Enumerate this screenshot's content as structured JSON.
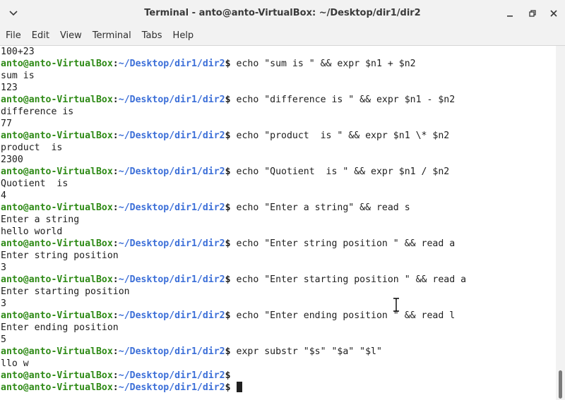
{
  "window": {
    "title": "Terminal - anto@anto-VirtualBox: ~/Desktop/dir1/dir2"
  },
  "menubar": {
    "items": [
      "File",
      "Edit",
      "View",
      "Terminal",
      "Tabs",
      "Help"
    ]
  },
  "prompt": {
    "user": "anto@anto-VirtualBox",
    "path": "~/Desktop/dir1/dir2",
    "colon": ":",
    "dollar": "$"
  },
  "terminal": {
    "output_0": "100+23",
    "cmd_1": " echo \"sum is \" && expr $n1 + $n2",
    "output_1a": "sum is",
    "output_1b": "123",
    "cmd_2": " echo \"difference is \" && expr $n1 - $n2",
    "output_2a": "difference is",
    "output_2b": "77",
    "cmd_3": " echo \"product  is \" && expr $n1 \\* $n2",
    "output_3a": "product  is",
    "output_3b": "2300",
    "cmd_4": " echo \"Quotient  is \" && expr $n1 / $n2",
    "output_4a": "Quotient  is",
    "output_4b": "4",
    "cmd_5": " echo \"Enter a string\" && read s",
    "output_5a": "Enter a string",
    "output_5b": "hello world",
    "cmd_6": " echo \"Enter string position \" && read a",
    "output_6a": "Enter string position",
    "output_6b": "3",
    "cmd_7": " echo \"Enter starting position \" && read a",
    "output_7a": "Enter starting position",
    "output_7b": "3",
    "cmd_8": " echo \"Enter ending position \" && read l",
    "output_8a": "Enter ending position",
    "output_8b": "5",
    "cmd_9": " expr substr \"$s\" \"$a\" \"$l\"",
    "output_9a": "llo w",
    "cmd_10": "",
    "cmd_11": " "
  }
}
